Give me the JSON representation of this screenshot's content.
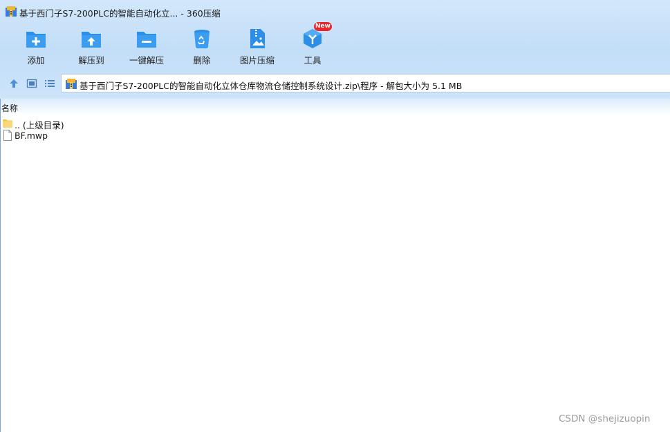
{
  "window": {
    "title": "基于西门子S7-200PLC的智能自动化立... - 360压缩",
    "app_icon": "archive-app-icon"
  },
  "toolbar": {
    "items": [
      {
        "label": "添加",
        "icon": "add-folder-icon"
      },
      {
        "label": "解压到",
        "icon": "extract-to-folder-icon"
      },
      {
        "label": "一键解压",
        "icon": "quick-extract-folder-icon"
      },
      {
        "label": "删除",
        "icon": "recycle-bin-icon"
      },
      {
        "label": "图片压缩",
        "icon": "image-compress-icon"
      },
      {
        "label": "工具",
        "icon": "tools-cube-icon"
      }
    ],
    "new_badge": "New"
  },
  "nav": {
    "icons": [
      "up-arrow-icon",
      "thumbnail-view-icon",
      "list-view-icon"
    ]
  },
  "address": {
    "path": "基于西门子S7-200PLC的智能自动化立体仓库物流仓储控制系统设计.zip\\程序 - 解包大小为 5.1 MB"
  },
  "list": {
    "column_name": "名称",
    "rows": [
      {
        "name": ".. (上级目录)",
        "icon": "folder-icon"
      },
      {
        "name": "BF.mwp",
        "icon": "file-icon"
      }
    ]
  },
  "watermark": "CSDN @shejizuopin",
  "colors": {
    "accent_blue": "#2b8fe8",
    "toolbar_bg": "#c8e0f9",
    "badge_red": "#e8262b"
  }
}
